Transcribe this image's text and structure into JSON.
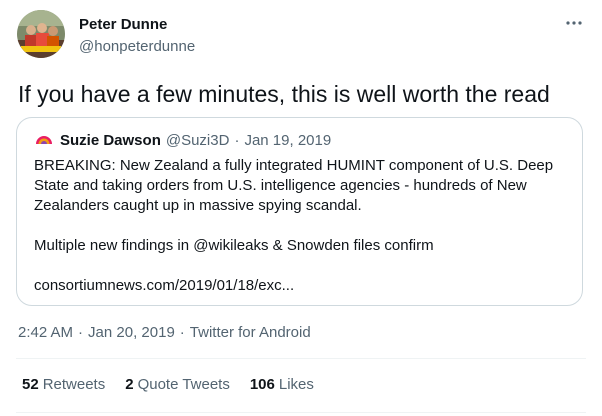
{
  "author": {
    "name": "Peter Dunne",
    "handle": "@honpeterdunne"
  },
  "more_icon": "more-horizontal-icon",
  "tweet_text": "If you have a few minutes, this is well worth the read",
  "quote": {
    "name": "Suzie Dawson",
    "handle": "@Suzi3D",
    "separator": "·",
    "date": "Jan 19, 2019",
    "lines": [
      "BREAKING: New Zealand a fully integrated HUMINT component of U.S. Deep",
      "State and taking orders from U.S. intelligence agencies - hundreds of New",
      "Zealanders caught up in massive spying scandal.",
      "Multiple new findings in @wikileaks & Snowden files confirm",
      "consortiumnews.com/2019/01/18/exc..."
    ]
  },
  "meta": {
    "time": "2:42 AM",
    "separator": "·",
    "date": "Jan 20, 2019",
    "source": "Twitter for Android"
  },
  "stats": {
    "retweets_count": "52",
    "retweets_label": "Retweets",
    "quotes_count": "2",
    "quotes_label": "Quote Tweets",
    "likes_count": "106",
    "likes_label": "Likes"
  },
  "colors": {
    "text_primary": "#0f1419",
    "text_secondary": "#536471",
    "border": "#cfd9de",
    "divider": "#eff3f4"
  }
}
